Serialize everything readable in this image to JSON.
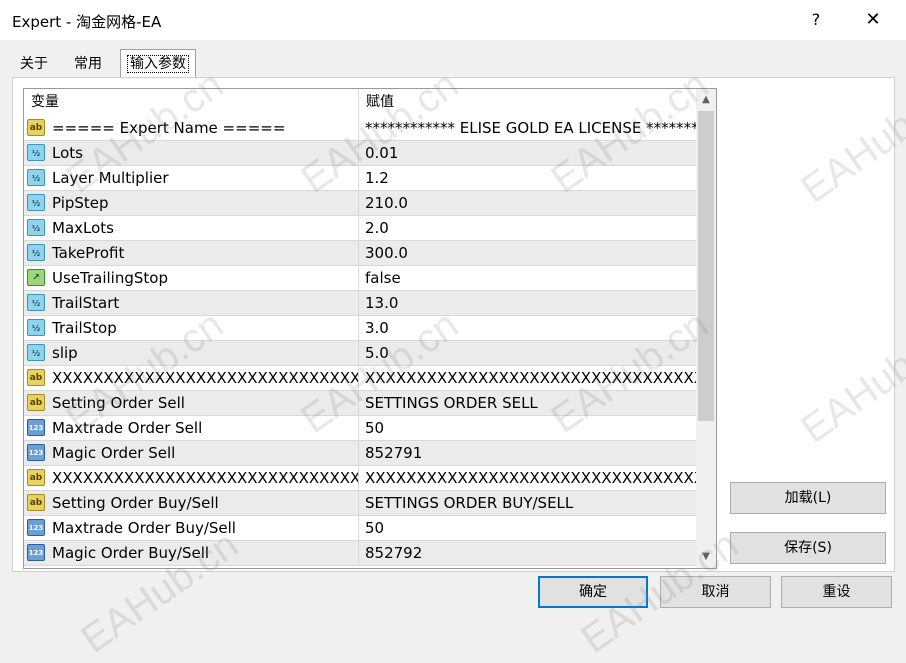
{
  "window": {
    "title": "Expert - 淘金网格-EA",
    "help": "?",
    "close": "✕"
  },
  "tabs": [
    {
      "label": "关于"
    },
    {
      "label": "常用"
    },
    {
      "label": "输入参数"
    }
  ],
  "grid": {
    "headers": {
      "name": "变量",
      "value": "赋值"
    },
    "rows": [
      {
        "icon": "ab",
        "name": "===== Expert Name =====",
        "value": "************ ELISE GOLD EA LICENSE *******..."
      },
      {
        "icon": "half",
        "name": "Lots",
        "value": "0.01"
      },
      {
        "icon": "half",
        "name": "Layer Multiplier",
        "value": "1.2"
      },
      {
        "icon": "half",
        "name": "PipStep",
        "value": "210.0"
      },
      {
        "icon": "half",
        "name": "MaxLots",
        "value": "2.0"
      },
      {
        "icon": "half",
        "name": "TakeProfit",
        "value": "300.0"
      },
      {
        "icon": "bool",
        "name": "UseTrailingStop",
        "value": "false"
      },
      {
        "icon": "half",
        "name": "TrailStart",
        "value": "13.0"
      },
      {
        "icon": "half",
        "name": "TrailStop",
        "value": "3.0"
      },
      {
        "icon": "half",
        "name": "slip",
        "value": "5.0"
      },
      {
        "icon": "ab",
        "name": "XXXXXXXXXXXXXXXXXXXXXXXXXXXXXXX...",
        "value": "XXXXXXXXXXXXXXXXXXXXXXXXXXXXXXXXXX"
      },
      {
        "icon": "ab",
        "name": "Setting Order Sell",
        "value": "SETTINGS ORDER SELL"
      },
      {
        "icon": "n123",
        "name": "Maxtrade Order Sell",
        "value": "50"
      },
      {
        "icon": "n123",
        "name": "Magic Order Sell",
        "value": "852791"
      },
      {
        "icon": "ab",
        "name": "XXXXXXXXXXXXXXXXXXXXXXXXXXXXXXX...",
        "value": "XXXXXXXXXXXXXXXXXXXXXXXXXXXXXXXXXX"
      },
      {
        "icon": "ab",
        "name": "Setting Order Buy/Sell",
        "value": "SETTINGS ORDER BUY/SELL"
      },
      {
        "icon": "n123",
        "name": "Maxtrade Order Buy/Sell",
        "value": "50"
      },
      {
        "icon": "n123",
        "name": "Magic Order Buy/Sell",
        "value": "852792"
      }
    ]
  },
  "icons": {
    "ab": "ab",
    "half": "½",
    "n123": "123",
    "bool": "↗"
  },
  "buttons": {
    "load": "加载(L)",
    "save": "保存(S)",
    "ok": "确定",
    "cancel": "取消",
    "reset": "重设"
  },
  "watermark": "EAHub.cn",
  "colors": {
    "primary_border": "#0078d7",
    "alt_row": "#ebebeb"
  }
}
